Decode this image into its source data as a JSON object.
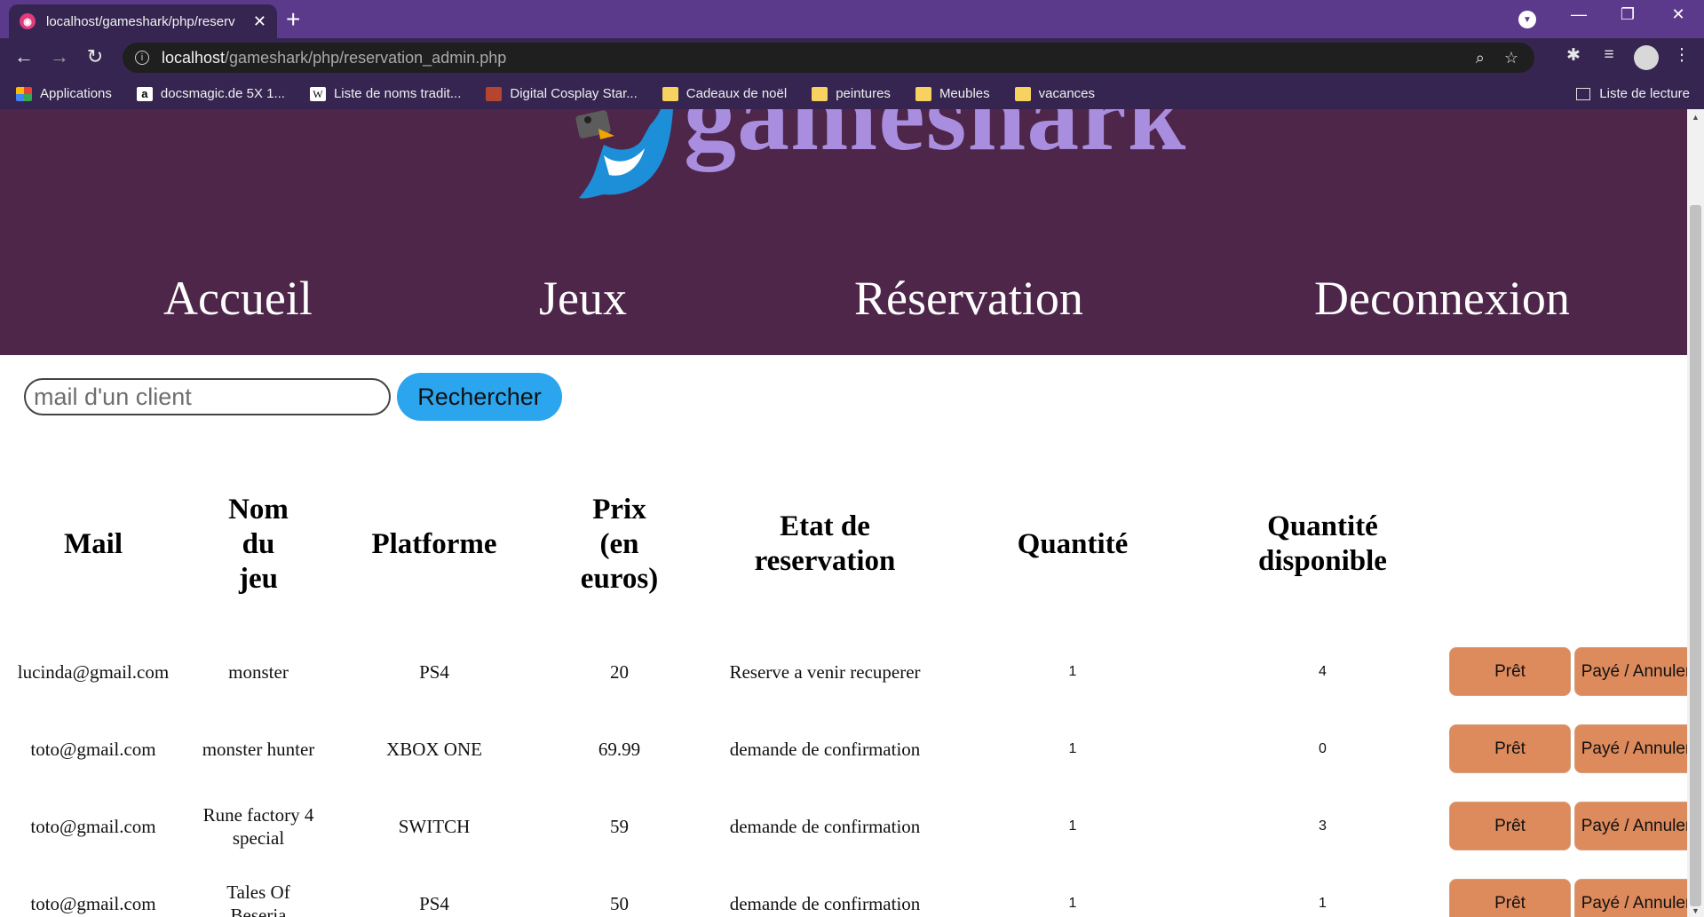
{
  "browser": {
    "tab_title": "localhost/gameshark/php/reserv",
    "tab_close": "✕",
    "new_tab": "+",
    "url_host": "localhost",
    "url_path": "/gameshark/php/reservation_admin.php",
    "bookmarks": [
      {
        "label": "Applications",
        "icon": "apps-grid-icon"
      },
      {
        "label": "docsmagic.de 5X 1...",
        "icon": "amazon-icon"
      },
      {
        "label": "Liste de noms tradit...",
        "icon": "wikipedia-icon"
      },
      {
        "label": "Digital Cosplay Star...",
        "icon": "cosplay-favicon"
      },
      {
        "label": "Cadeaux de noël",
        "icon": "folder-icon"
      },
      {
        "label": "peintures",
        "icon": "folder-icon"
      },
      {
        "label": "Meubles",
        "icon": "folder-icon"
      },
      {
        "label": "vacances",
        "icon": "folder-icon"
      }
    ],
    "reading_list": "Liste de lecture"
  },
  "site": {
    "logo_text": "gameshark",
    "nav": [
      "Accueil",
      "Jeux",
      "Réservation",
      "Deconnexion"
    ]
  },
  "search": {
    "placeholder": "mail d'un client",
    "value": "",
    "button_label": "Rechercher"
  },
  "table": {
    "headers": {
      "mail": "Mail",
      "nom_l1": "Nom",
      "nom_l2": "du",
      "nom_l3": "jeu",
      "platforme": "Platforme",
      "prix_l1": "Prix",
      "prix_l2": "(en",
      "prix_l3": "euros)",
      "etat_l1": "Etat de",
      "etat_l2": "reservation",
      "quantite": "Quantité",
      "qdispo_l1": "Quantité",
      "qdispo_l2": "disponible"
    },
    "button_pret": "Prêt",
    "button_paye": "Payé / Annuler",
    "rows": [
      {
        "mail": "lucinda@gmail.com",
        "jeu_l1": "monster",
        "jeu_l2": "",
        "platforme": "PS4",
        "prix": "20",
        "etat": "Reserve a venir recuperer",
        "quantite": "1",
        "dispo": "4"
      },
      {
        "mail": "toto@gmail.com",
        "jeu_l1": "monster hunter",
        "jeu_l2": "",
        "platforme": "XBOX ONE",
        "prix": "69.99",
        "etat": "demande de confirmation",
        "quantite": "1",
        "dispo": "0"
      },
      {
        "mail": "toto@gmail.com",
        "jeu_l1": "Rune factory 4",
        "jeu_l2": "special",
        "platforme": "SWITCH",
        "prix": "59",
        "etat": "demande de confirmation",
        "quantite": "1",
        "dispo": "3"
      },
      {
        "mail": "toto@gmail.com",
        "jeu_l1": "Tales Of",
        "jeu_l2": "Beseria",
        "platforme": "PS4",
        "prix": "50",
        "etat": "demande de confirmation",
        "quantite": "1",
        "dispo": "1"
      }
    ]
  },
  "colors": {
    "header_bg": "#4e2649",
    "logo": "#a98ee0",
    "search_button": "#2aa5ee",
    "action_button": "#dd8a5c",
    "browser_frame": "#5b3a8c"
  }
}
